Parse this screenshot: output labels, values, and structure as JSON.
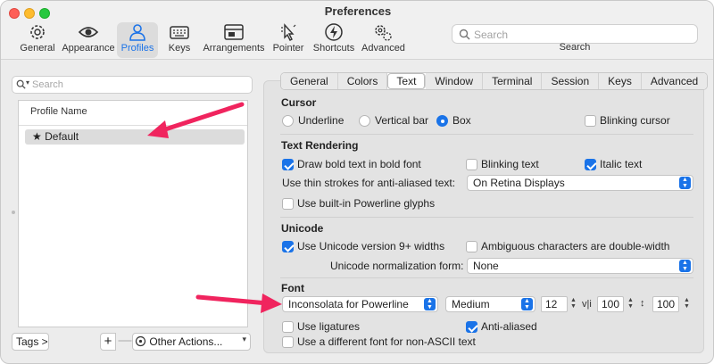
{
  "window": {
    "title": "Preferences"
  },
  "toolbar": {
    "items": [
      {
        "label": "General",
        "icon": "gear-icon"
      },
      {
        "label": "Appearance",
        "icon": "eye-icon"
      },
      {
        "label": "Profiles",
        "icon": "person-icon"
      },
      {
        "label": "Keys",
        "icon": "keyboard-icon"
      },
      {
        "label": "Arrangements",
        "icon": "window-icon"
      },
      {
        "label": "Pointer",
        "icon": "pointer-icon"
      },
      {
        "label": "Shortcuts",
        "icon": "lightning-icon"
      },
      {
        "label": "Advanced",
        "icon": "gears-icon"
      }
    ],
    "selected": "Profiles",
    "search_placeholder": "Search",
    "search_caption": "Search"
  },
  "sidebar": {
    "search_placeholder": "Search",
    "column_header": "Profile Name",
    "profiles": [
      {
        "name": "Default",
        "star": "★"
      }
    ],
    "tags_button": "Tags >",
    "add_button": "+",
    "remove_button": "—",
    "other_actions": "Other Actions..."
  },
  "tabs": [
    "General",
    "Colors",
    "Text",
    "Window",
    "Terminal",
    "Session",
    "Keys",
    "Advanced"
  ],
  "active_tab": "Text",
  "cursor": {
    "heading": "Cursor",
    "underline": "Underline",
    "vertical_bar": "Vertical bar",
    "box": "Box",
    "blinking": "Blinking cursor",
    "selected": "Box",
    "blinking_checked": false
  },
  "text_rendering": {
    "heading": "Text Rendering",
    "bold_in_bold": "Draw bold text in bold font",
    "bold_in_bold_checked": true,
    "blinking_text": "Blinking text",
    "blinking_text_checked": false,
    "italic_text": "Italic text",
    "italic_text_checked": true,
    "thin_strokes_label": "Use thin strokes for anti-aliased text:",
    "thin_strokes_value": "On Retina Displays",
    "powerline": "Use built-in Powerline glyphs",
    "powerline_checked": false
  },
  "unicode": {
    "heading": "Unicode",
    "unicode9": "Use Unicode version 9+ widths",
    "unicode9_checked": true,
    "ambiguous": "Ambiguous characters are double-width",
    "ambiguous_checked": false,
    "normalization_label": "Unicode normalization form:",
    "normalization_value": "None"
  },
  "font": {
    "heading": "Font",
    "family": "Inconsolata for Powerline",
    "weight": "Medium",
    "size": "12",
    "h_spacing_icon": "v|i",
    "h_spacing": "100",
    "v_spacing_icon": "↕",
    "v_spacing": "100",
    "ligatures": "Use ligatures",
    "ligatures_checked": false,
    "anti_aliased": "Anti-aliased",
    "anti_aliased_checked": true,
    "non_ascii": "Use a different font for non-ASCII text",
    "non_ascii_checked": false
  },
  "colors": {
    "accent": "#1a73e8",
    "annotation_arrow": "#f0245e"
  }
}
